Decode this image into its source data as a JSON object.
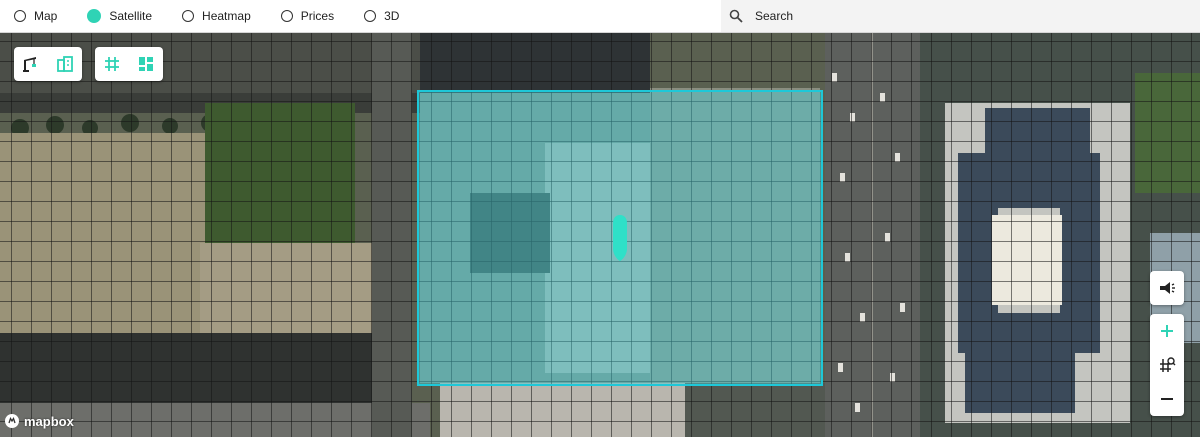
{
  "layers": {
    "options": [
      {
        "label": "Map",
        "selected": false
      },
      {
        "label": "Satellite",
        "selected": true
      },
      {
        "label": "Heatmap",
        "selected": false
      },
      {
        "label": "Prices",
        "selected": false
      },
      {
        "label": "3D",
        "selected": false
      }
    ]
  },
  "search": {
    "placeholder": "Search",
    "icon": "search-icon"
  },
  "map": {
    "base": "satellite imagery",
    "grid": true,
    "selection_color": "#1ec8d8",
    "marker_color": "#2fe0c8"
  },
  "controls": {
    "top_left": [
      "crane-icon",
      "buildings-icon",
      "grid-icon",
      "dashboard-icon"
    ],
    "right": [
      "announce-icon",
      "zoom-in-icon",
      "grid-zoom-icon",
      "zoom-out-icon"
    ]
  },
  "colors": {
    "accent": "#2fd3b5",
    "primary_text": "#222222"
  },
  "attribution": {
    "logo_text": "mapbox"
  }
}
